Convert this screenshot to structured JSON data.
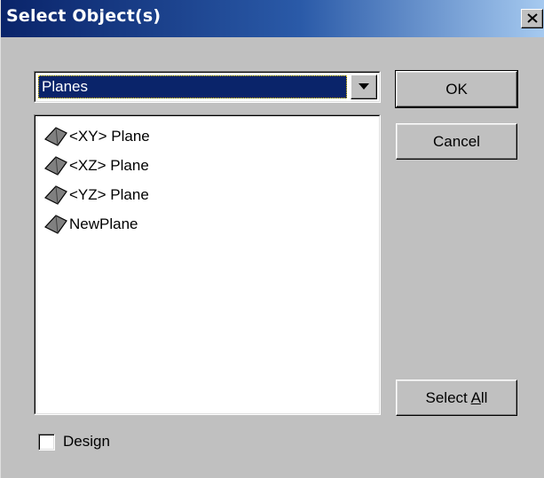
{
  "window": {
    "title": "Select Object(s)",
    "close_glyph": "×"
  },
  "type_select": {
    "selected": "Planes"
  },
  "object_list": {
    "icon": "plane-icon",
    "items": [
      {
        "label": "<XY> Plane"
      },
      {
        "label": "<XZ> Plane"
      },
      {
        "label": "<YZ> Plane"
      },
      {
        "label": "NewPlane"
      }
    ]
  },
  "buttons": {
    "ok": "OK",
    "cancel": "Cancel",
    "select_all_prefix": "Select ",
    "select_all_accel": "A",
    "select_all_suffix": "ll"
  },
  "design_checkbox": {
    "label": "Design",
    "checked": false
  },
  "colors": {
    "titlebar_start": "#0a246a",
    "titlebar_end": "#a6caf0",
    "selection": "#0a246a",
    "face": "#c0c0c0"
  }
}
